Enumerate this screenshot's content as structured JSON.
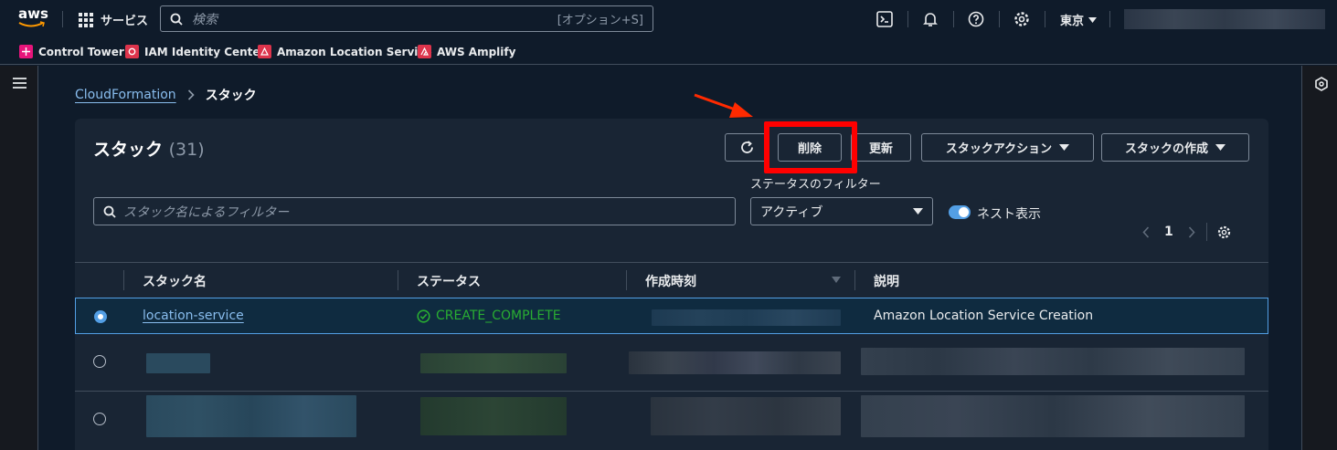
{
  "topnav": {
    "logo": "aws",
    "services_label": "サービス",
    "search_placeholder": "検索",
    "search_shortcut": "[オプション+S]",
    "region": "東京",
    "icons": [
      "cloudshell-icon",
      "notifications-icon",
      "help-icon",
      "settings-icon"
    ]
  },
  "favorites": [
    {
      "label": "Control Tower",
      "color": "#e7157b"
    },
    {
      "label": "IAM Identity Center",
      "color": "#dd344c"
    },
    {
      "label": "Amazon Location Service",
      "color": "#dd344c"
    },
    {
      "label": "AWS Amplify",
      "color": "#dd344c"
    }
  ],
  "breadcrumb": {
    "parent": "CloudFormation",
    "current": "スタック"
  },
  "panel": {
    "title": "スタック",
    "count": "(31)",
    "buttons": {
      "delete": "削除",
      "update": "更新",
      "stack_actions": "スタックアクション",
      "create_stack": "スタックの作成"
    },
    "filter_placeholder": "スタック名によるフィルター",
    "status_filter_label": "ステータスのフィルター",
    "status_filter_value": "アクティブ",
    "nested_label": "ネスト表示",
    "page": "1"
  },
  "table": {
    "columns": [
      "スタック名",
      "ステータス",
      "作成時刻",
      "説明"
    ],
    "rows": [
      {
        "name": "location-service",
        "status": "CREATE_COMPLETE",
        "description": "Amazon Location Service Creation",
        "selected": true
      }
    ]
  },
  "colors": {
    "accent": "#539fe5",
    "link": "#89bdee",
    "success": "#29ad32",
    "highlight": "#ff0000",
    "arrow": "#ff2a00"
  }
}
